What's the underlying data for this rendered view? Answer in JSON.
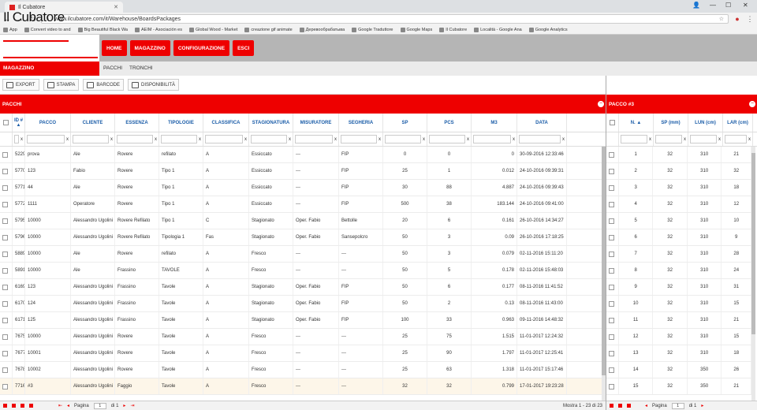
{
  "browser": {
    "tab_title": "Il Cubatore",
    "url": "www.ilcubatore.com/it/Warehouse/BoardsPackages",
    "bookmarks": [
      "App",
      "Convert video to and",
      "Big Beautiful Black Wa",
      "AEIM - Asociación es",
      "Global Wood - Market",
      "creazione gif animate",
      "Деревообрабатыва",
      "Google Traduttore",
      "Google Maps",
      "Il Cubatore",
      "Località - Google Ana",
      "Google Analytics"
    ]
  },
  "app": {
    "logo": "Il Cubatore",
    "menu": [
      "HOME",
      "MAGAZZINO",
      "CONFIGURAZIONE",
      "ESCI"
    ],
    "section": "MAGAZZINO",
    "subtabs": [
      "PACCHI",
      "TRONCHI"
    ],
    "toolbar": [
      "EXPORT",
      "STAMPA",
      "BARCODE",
      "DISPONIBILITÀ"
    ]
  },
  "left_panel": {
    "title": "PACCHI",
    "columns": [
      "ID # ▲",
      "PACCO",
      "CLIENTE",
      "ESSENZA",
      "TIPOLOGIE",
      "CLASSIFICA",
      "STAGIONATURA",
      "MISURATORE",
      "SEGHERIA",
      "SP",
      "PCS",
      "M3",
      "DATA"
    ],
    "rows": [
      [
        "5229",
        "prova",
        "Ale",
        "Rovere",
        "refilato",
        "A",
        "Essiccato",
        "---",
        "FIP",
        "0",
        "0",
        "0",
        "30-09-2016 12:33:46"
      ],
      [
        "5770",
        "123",
        "Fabio",
        "Rovere",
        "Tipo 1",
        "A",
        "Essiccato",
        "---",
        "FIP",
        "25",
        "1",
        "0.012",
        "24-10-2016 09:39:31"
      ],
      [
        "5771",
        "44",
        "Ale",
        "Rovere",
        "Tipo 1",
        "A",
        "Essiccato",
        "---",
        "FIP",
        "30",
        "88",
        "4.887",
        "24-10-2016 09:39:43"
      ],
      [
        "5772",
        "1111",
        "Operatore",
        "Rovere",
        "Tipo 1",
        "A",
        "Essiccato",
        "---",
        "FIP",
        "500",
        "38",
        "183.144",
        "24-10-2016 09:41:00"
      ],
      [
        "5795",
        "10000",
        "Alessandro Ugolini",
        "Rovere Refilato",
        "Tipo 1",
        "C",
        "Stagionato",
        "Oper. Fabio",
        "Bettolle",
        "20",
        "6",
        "0.161",
        "26-10-2016 14:34:27"
      ],
      [
        "5796",
        "10000",
        "Alessandro Ugolini",
        "Rovere Refilato",
        "Tipologia 1",
        "Fas",
        "Stagionato",
        "Oper. Fabio",
        "Sansepolcro",
        "50",
        "3",
        "0.09",
        "26-10-2016 17:18:25"
      ],
      [
        "5889",
        "10000",
        "Ale",
        "Rovere",
        "refilato",
        "A",
        "Fresco",
        "---",
        "---",
        "50",
        "3",
        "0.079",
        "02-11-2016 15:11:20"
      ],
      [
        "5891",
        "10000",
        "Ale",
        "Frassino",
        "TAVOLE",
        "A",
        "Fresco",
        "---",
        "---",
        "50",
        "5",
        "0.178",
        "02-11-2016 15:48:03"
      ],
      [
        "6169",
        "123",
        "Alessandro Ugolini",
        "Frassino",
        "Tavole",
        "A",
        "Stagionato",
        "Oper. Fabio",
        "FIP",
        "50",
        "6",
        "0.177",
        "08-11-2016 11:41:52"
      ],
      [
        "6170",
        "124",
        "Alessandro Ugolini",
        "Frassino",
        "Tavole",
        "A",
        "Stagionato",
        "Oper. Fabio",
        "FIP",
        "50",
        "2",
        "0.13",
        "08-11-2016 11:43:00"
      ],
      [
        "6171",
        "125",
        "Alessandro Ugolini",
        "Frassino",
        "Tavole",
        "A",
        "Stagionato",
        "Oper. Fabio",
        "FIP",
        "100",
        "33",
        "0.963",
        "09-11-2016 14:48:32"
      ],
      [
        "7675",
        "10000",
        "Alessandro Ugolini",
        "Rovere",
        "Tavole",
        "A",
        "Fresco",
        "---",
        "---",
        "25",
        "75",
        "1.515",
        "11-01-2017 12:24:32"
      ],
      [
        "7677",
        "10001",
        "Alessandro Ugolini",
        "Rovere",
        "Tavole",
        "A",
        "Fresco",
        "---",
        "---",
        "25",
        "90",
        "1.797",
        "11-01-2017 12:25:41"
      ],
      [
        "7678",
        "10002",
        "Alessandro Ugolini",
        "Rovere",
        "Tavole",
        "A",
        "Fresco",
        "---",
        "---",
        "25",
        "63",
        "1.318",
        "11-01-2017 15:17:46"
      ],
      [
        "7716",
        "#3",
        "Alessandro Ugolini",
        "Faggio",
        "Tavole",
        "A",
        "Fresco",
        "---",
        "---",
        "32",
        "32",
        "0.799",
        "17-01-2017 19:23:28"
      ]
    ],
    "pager": {
      "label": "Pagina",
      "page": "1",
      "of": "di 1",
      "records": "Mostra 1 - 23 di 23"
    }
  },
  "right_panel": {
    "title": "PACCO #3",
    "columns": [
      "N. ▲",
      "SP (mm)",
      "LUN (cm)",
      "LAR (cm)"
    ],
    "rows": [
      [
        "1",
        "32",
        "310",
        "21"
      ],
      [
        "2",
        "32",
        "310",
        "32"
      ],
      [
        "3",
        "32",
        "310",
        "18"
      ],
      [
        "4",
        "32",
        "310",
        "12"
      ],
      [
        "5",
        "32",
        "310",
        "10"
      ],
      [
        "6",
        "32",
        "310",
        "9"
      ],
      [
        "7",
        "32",
        "310",
        "28"
      ],
      [
        "8",
        "32",
        "310",
        "24"
      ],
      [
        "9",
        "32",
        "310",
        "31"
      ],
      [
        "10",
        "32",
        "310",
        "15"
      ],
      [
        "11",
        "32",
        "310",
        "21"
      ],
      [
        "12",
        "32",
        "310",
        "15"
      ],
      [
        "13",
        "32",
        "310",
        "18"
      ],
      [
        "14",
        "32",
        "350",
        "26"
      ],
      [
        "15",
        "32",
        "350",
        "21"
      ]
    ],
    "pager": {
      "label": "Pagina",
      "page": "1",
      "of": "di 1"
    }
  },
  "colors": {
    "accent": "#e00000",
    "header_gray": "#b5b5b5",
    "link_blue": "#1a5ca8"
  }
}
